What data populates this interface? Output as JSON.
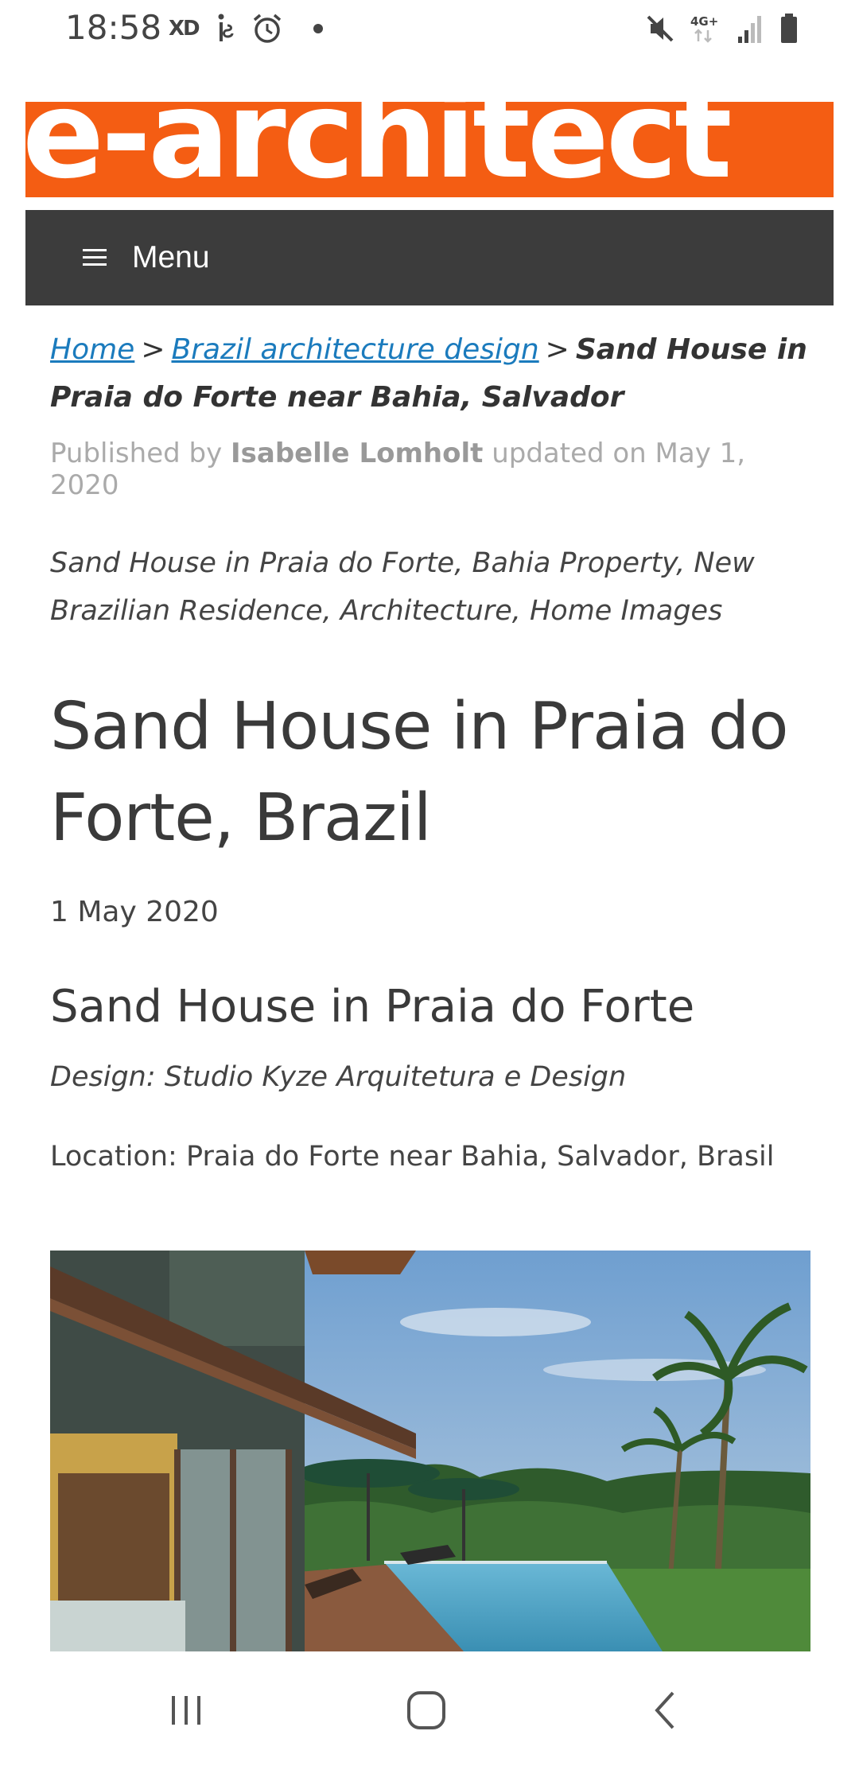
{
  "status_bar": {
    "time": "18:58",
    "xd_label": "XD",
    "network_label": "4G+"
  },
  "logo": {
    "text": "e-architect",
    "background_color": "#f45d13"
  },
  "menu": {
    "label": "Menu"
  },
  "breadcrumb": {
    "home": "Home",
    "separator": ">",
    "category": "Brazil architecture design",
    "current": "Sand House in Praia do Forte near Bahia, Salvador"
  },
  "byline": {
    "prefix": "Published by",
    "author": "Isabelle Lomholt",
    "suffix": "updated on May 1, 2020"
  },
  "tagline": "Sand House in Praia do Forte, Bahia Property, New Brazilian Residence, Architecture, Home Images",
  "page_title": "Sand House in Praia do Forte, Brazil",
  "date": "1 May 2020",
  "section_heading": "Sand House in Praia do Forte",
  "design_line": "Design: Studio Kyze Arquitetura e Design",
  "location_line": "Location: Praia do Forte near Bahia, Salvador, Brasil",
  "colors": {
    "link": "#1b7bbd",
    "menu_bar": "#3c3c3c",
    "text": "#333333"
  },
  "icons": {
    "status": [
      "xd-icon",
      "fitness-icon",
      "alarm-icon",
      "notification-dot-icon",
      "mute-icon",
      "network-icon",
      "signal-icon",
      "battery-icon"
    ],
    "nav": [
      "recents-icon",
      "home-icon",
      "back-icon"
    ]
  }
}
